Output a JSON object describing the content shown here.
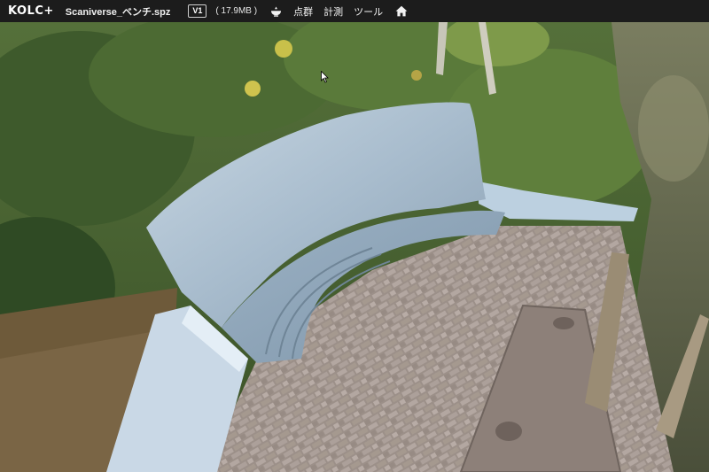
{
  "toolbar": {
    "logo": "KOLC+",
    "file_name": "Scaniverse_ベンチ.spz",
    "version_badge": "V1",
    "file_size": "( 17.9MB )",
    "menu": {
      "point_cloud": "点群",
      "measure": "計測",
      "tools": "ツール"
    },
    "icons": {
      "view": "bowl-view-icon",
      "home": "home-icon"
    }
  },
  "viewport": {
    "scene": "3d-gaussian-splat-bench"
  },
  "colors": {
    "toolbar_bg": "#1c1c1c",
    "toolbar_text": "#f2f2f2"
  }
}
